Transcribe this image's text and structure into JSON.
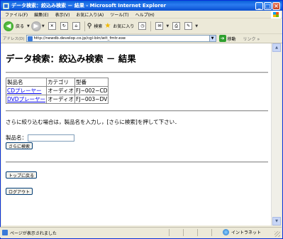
{
  "window": {
    "title": "データ検索：絞込み検索 － 結果 - Microsoft Internet Explorer",
    "controls": [
      "_",
      "□",
      "×"
    ]
  },
  "menu": [
    "ファイル(F)",
    "編集(E)",
    "表示(V)",
    "お気に入り(A)",
    "ツール(T)",
    "ヘルプ(H)"
  ],
  "toolbar": {
    "back_label": "戻る",
    "search_label": "検索",
    "favorites_label": "お気に入り"
  },
  "address": {
    "label": "アドレス(D)",
    "url": "http://newdb.develop.co.jp/cgi-bin/wit_fmtr.exe",
    "go_label": "移動",
    "links_label": "リンク »"
  },
  "page": {
    "title": "データ検索：絞込み検索 － 結果",
    "table": {
      "headers": [
        "製品名",
        "カテゴリ",
        "型番"
      ],
      "rows": [
        [
          "CDプレーヤー",
          "オーディオ",
          "FJ−002−CD"
        ],
        [
          "DVDプレーヤー",
          "オーディオ",
          "FJ−003−DV"
        ]
      ]
    },
    "instruction": "さらに絞り込む場合は，製品名を入力し，[さらに検索]を押して下さい．",
    "field_label": "製品名：",
    "field_value": "",
    "search_button": "さらに検索",
    "top_button": "トップに戻る",
    "logout_button": "ログアウト"
  },
  "status": {
    "text": "ページが表示されました",
    "zone": "イントラネット"
  }
}
